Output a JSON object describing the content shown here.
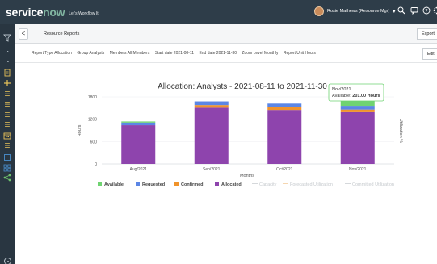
{
  "header": {
    "logo_service": "service",
    "logo_now": "now",
    "tagline": "Let's Workflow It!",
    "user_name": "Rosie Mathews (Resource Mgr)"
  },
  "titlebar": {
    "back_label": "<",
    "title": "Resource Reports",
    "export_label": "Export"
  },
  "filters": {
    "items": [
      "Report Type Allocation",
      "Group Analysts",
      "Members All Members",
      "Start date 2021-08-11",
      "End date 2021-11-30",
      "Zoom Level Monthly",
      "Report Unit Hours"
    ],
    "edit_label": "Edit"
  },
  "colors": {
    "available": "#6fd371",
    "requested": "#5b86e5",
    "confirmed": "#f0932b",
    "allocated": "#8e44ad",
    "header_bg": "#2e3d49",
    "sidebar_bg": "#293641",
    "tooltip_border": "#6fd371"
  },
  "icons": {
    "sidebar": [
      "filter-icon",
      "speedometer-icon",
      "speedometer-icon",
      "clipboard-icon",
      "plus-icon",
      "list-icon",
      "list-icon",
      "list-icon",
      "list-icon",
      "calendar-icon",
      "list-icon",
      "square-icon",
      "grid-icon",
      "share-icon",
      "settings-circle-icon"
    ],
    "header": [
      "search-icon",
      "chat-icon",
      "help-icon",
      "settings-icon"
    ]
  },
  "chart_data": {
    "type": "bar",
    "stacked": true,
    "title": "Allocation: Analysts - 2021-08-11 to 2021-11-30",
    "xlabel": "Months",
    "ylabel": "Hours",
    "y2label": "Utilization %",
    "categories": [
      "Aug/2021",
      "Sep/2021",
      "Oct/2021",
      "Nov/2021"
    ],
    "y_ticks": [
      "0",
      "600",
      "1200",
      "1800"
    ],
    "ylim": [
      0,
      1800
    ],
    "series": [
      {
        "name": "Allocated",
        "color": "#8e44ad",
        "values": [
          1040,
          1510,
          1450,
          1390
        ]
      },
      {
        "name": "Confirmed",
        "color": "#f0932b",
        "values": [
          0,
          70,
          70,
          70
        ]
      },
      {
        "name": "Requested",
        "color": "#5b86e5",
        "values": [
          70,
          100,
          100,
          100
        ]
      },
      {
        "name": "Available",
        "color": "#6fd371",
        "values": [
          30,
          0,
          0,
          201
        ]
      }
    ],
    "legend": [
      {
        "name": "Available",
        "color": "#6fd371",
        "kind": "square"
      },
      {
        "name": "Requested",
        "color": "#5b86e5",
        "kind": "square"
      },
      {
        "name": "Confirmed",
        "color": "#f0932b",
        "kind": "square"
      },
      {
        "name": "Allocated",
        "color": "#8e44ad",
        "kind": "square"
      },
      {
        "name": "Capacity",
        "color": "#d5d8db",
        "kind": "line"
      },
      {
        "name": "Forecasted Utilization",
        "color": "#f5d6b0",
        "kind": "line"
      },
      {
        "name": "Committed Utilization",
        "color": "#d5d8db",
        "kind": "line"
      }
    ],
    "legend_position": "bottom",
    "tooltip": {
      "title": "Nov/2021",
      "label": "Available:",
      "value": "201.00 Hours"
    }
  }
}
